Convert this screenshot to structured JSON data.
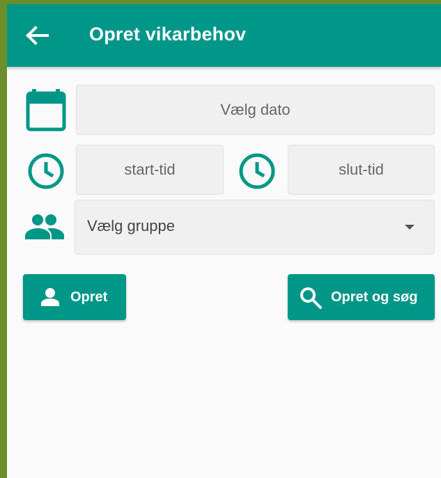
{
  "appbar": {
    "title": "Opret vikarbehov",
    "back_icon": "arrow-left-icon",
    "background": "#009688"
  },
  "form": {
    "date": {
      "icon": "calendar-icon",
      "placeholder": "Vælg dato"
    },
    "start_time": {
      "icon": "clock-icon",
      "placeholder": "start-tid"
    },
    "end_time": {
      "icon": "clock-icon",
      "placeholder": "slut-tid"
    },
    "group": {
      "icon": "people-icon",
      "placeholder": "Vælg gruppe"
    }
  },
  "buttons": {
    "create": {
      "label": "Opret",
      "icon": "person-icon"
    },
    "create_search": {
      "label": "Opret og søg",
      "icon": "search-icon"
    }
  },
  "colors": {
    "accent": "#009688",
    "field_bg": "#f0f0f0",
    "page_bg": "#fafafa",
    "frame": "#6b8f2a"
  }
}
